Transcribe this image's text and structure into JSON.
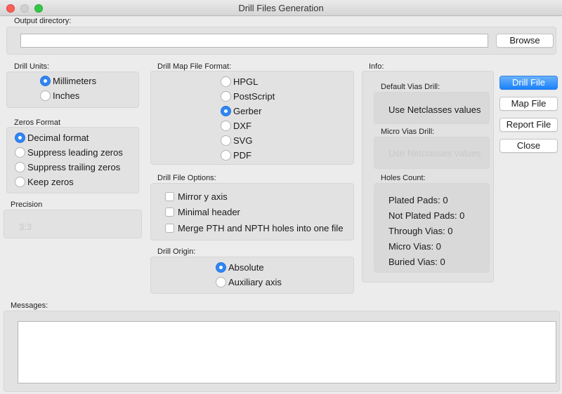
{
  "window": {
    "title": "Drill Files Generation"
  },
  "output": {
    "label": "Output directory:",
    "value": "",
    "browse_label": "Browse"
  },
  "drill_units": {
    "label": "Drill Units:",
    "options": [
      "Millimeters",
      "Inches"
    ],
    "selected": "Millimeters"
  },
  "zeros_format": {
    "label": "Zeros Format",
    "options": [
      "Decimal format",
      "Suppress leading zeros",
      "Suppress trailing zeros",
      "Keep zeros"
    ],
    "selected": "Decimal format"
  },
  "precision": {
    "label": "Precision",
    "value": "3:3"
  },
  "map_format": {
    "label": "Drill Map File Format:",
    "options": [
      "HPGL",
      "PostScript",
      "Gerber",
      "DXF",
      "SVG",
      "PDF"
    ],
    "selected": "Gerber"
  },
  "file_options": {
    "label": "Drill File Options:",
    "options": [
      "Mirror y axis",
      "Minimal header",
      "Merge PTH and NPTH holes into one file"
    ]
  },
  "origin": {
    "label": "Drill Origin:",
    "options": [
      "Absolute",
      "Auxiliary axis"
    ],
    "selected": "Absolute"
  },
  "info": {
    "label": "Info:",
    "default_vias_label": "Default Vias Drill:",
    "default_vias_value": "Use Netclasses values",
    "micro_vias_label": "Micro Vias Drill:",
    "micro_vias_value": "Use Netclasses values",
    "holes_label": "Holes Count:",
    "holes": [
      "Plated Pads: 0",
      "Not Plated Pads: 0",
      "Through Vias: 0",
      "Micro Vias: 0",
      "Buried Vias: 0"
    ]
  },
  "actions": {
    "drill_file": "Drill File",
    "map_file": "Map File",
    "report_file": "Report File",
    "close": "Close"
  },
  "messages": {
    "label": "Messages:",
    "value": ""
  }
}
